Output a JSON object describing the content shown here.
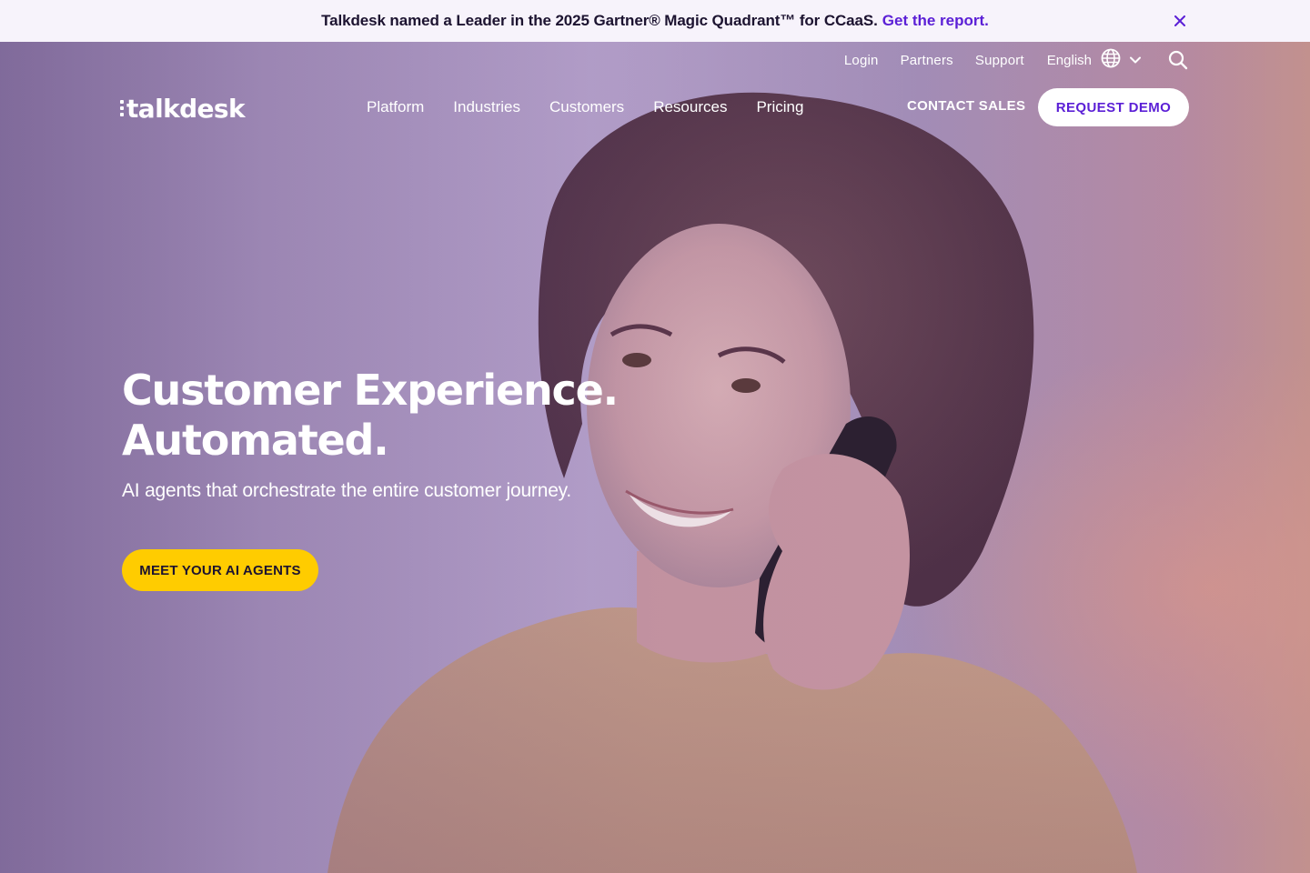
{
  "announcement": {
    "text": "Talkdesk named a Leader in the 2025 Gartner® Magic Quadrant™ for CCaaS.",
    "link_label": "Get the report.",
    "close_icon": "close-icon"
  },
  "utility_nav": {
    "items": [
      "Login",
      "Partners",
      "Support"
    ],
    "language": "English",
    "language_icon": "globe-icon",
    "dropdown_icon": "chevron-down-icon",
    "search_icon": "search-icon"
  },
  "brand": {
    "logo_text": "talkdesk"
  },
  "main_nav": {
    "items": [
      "Platform",
      "Industries",
      "Customers",
      "Resources",
      "Pricing"
    ],
    "contact_label": "CONTACT SALES",
    "demo_label": "REQUEST DEMO"
  },
  "hero": {
    "headline_line1": "Customer Experience.",
    "headline_line2": "Automated.",
    "subhead": "AI agents that orchestrate the entire customer journey.",
    "cta_label": "MEET YOUR AI AGENTS",
    "image_description_icon": "hero-photo"
  },
  "colors": {
    "accent_purple": "#5b1fd6",
    "cta_yellow": "#ffcc00",
    "announce_bg": "#f7f3fb"
  }
}
